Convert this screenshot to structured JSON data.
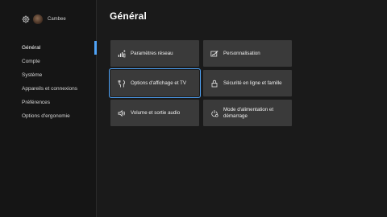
{
  "profile": {
    "gamertag": "Cambee",
    "settings_icon": "gear-icon",
    "avatar": "avatar"
  },
  "sidebar": {
    "items": [
      {
        "label": "Général",
        "active": true
      },
      {
        "label": "Compte",
        "active": false
      },
      {
        "label": "Système",
        "active": false
      },
      {
        "label": "Appareils et connexions",
        "active": false
      },
      {
        "label": "Préférences",
        "active": false
      },
      {
        "label": "Options d'ergonomie",
        "active": false
      }
    ]
  },
  "main": {
    "title": "Général",
    "tiles": [
      {
        "label": "Paramètres réseau",
        "icon": "network-icon"
      },
      {
        "label": "Personnalisation",
        "icon": "personalization-icon"
      },
      {
        "label": "Options d'affichage et TV",
        "icon": "display-tv-icon",
        "focused": true
      },
      {
        "label": "Sécurité en ligne et famille",
        "icon": "lock-icon"
      },
      {
        "label": "Volume et sortie audio",
        "icon": "speaker-icon"
      },
      {
        "label": "Mode d'alimentation et démarrage",
        "icon": "power-icon"
      }
    ]
  },
  "colors": {
    "background": "#1a1a1a",
    "sidebar": "#151515",
    "tile": "#3a3a3a",
    "accent": "#4fa3f7",
    "text": "#ffffff"
  }
}
